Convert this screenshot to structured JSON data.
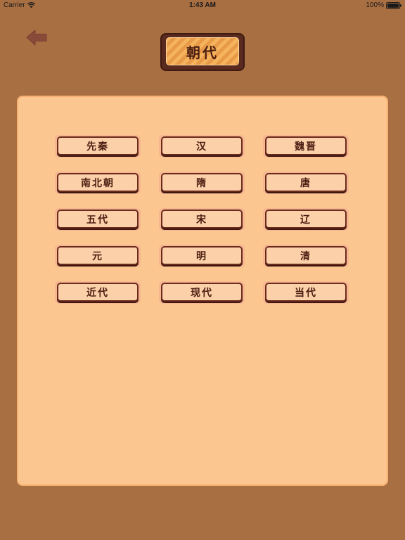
{
  "status_bar": {
    "carrier": "Carrier",
    "time": "1:43 AM",
    "battery": "100%"
  },
  "icons": {
    "back": "back-arrow-icon",
    "wifi": "wifi-icon",
    "battery": "battery-icon"
  },
  "colors": {
    "background": "#a86f42",
    "panel": "#fbc690",
    "button_face": "#fcd0a8",
    "button_border": "#6a2a1c",
    "text": "#4a1e12",
    "title_stripe_light": "#f6b35e",
    "title_stripe_dark": "#e89a47",
    "back_arrow": "#8a4a3a"
  },
  "header": {
    "title": "朝代"
  },
  "dynasties": [
    {
      "label": "先秦"
    },
    {
      "label": "汉"
    },
    {
      "label": "魏晋"
    },
    {
      "label": "南北朝"
    },
    {
      "label": "隋"
    },
    {
      "label": "唐"
    },
    {
      "label": "五代"
    },
    {
      "label": "宋"
    },
    {
      "label": "辽"
    },
    {
      "label": "元"
    },
    {
      "label": "明"
    },
    {
      "label": "清"
    },
    {
      "label": "近代"
    },
    {
      "label": "现代"
    },
    {
      "label": "当代"
    }
  ]
}
